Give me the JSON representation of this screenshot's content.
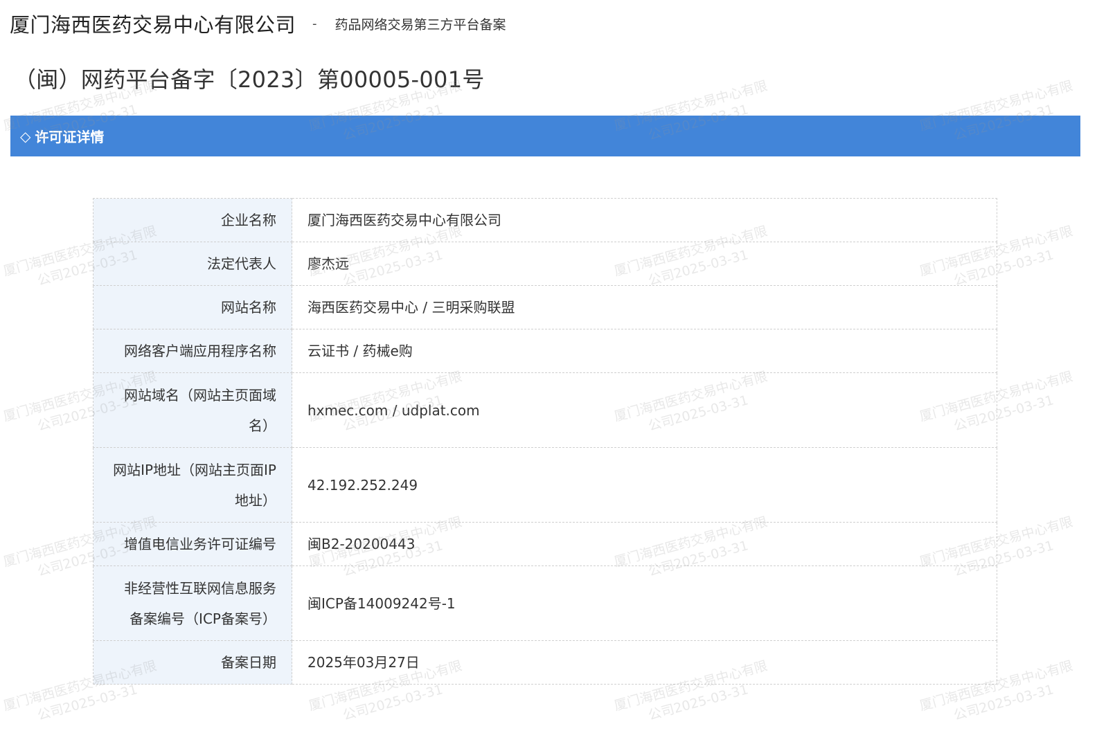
{
  "header": {
    "company": "厦门海西医药交易中心有限公司",
    "separator": "-",
    "subtitle": "药品网络交易第三方平台备案",
    "record_number": "（闽）网药平台备字〔2023〕第00005-001号"
  },
  "section": {
    "icon": "diamond-outline-icon",
    "icon_glyph": "◇",
    "title": "许可证详情",
    "bar_color": "#4285d9"
  },
  "rows": [
    {
      "label": "企业名称",
      "value": "厦门海西医药交易中心有限公司"
    },
    {
      "label": "法定代表人",
      "value": "廖杰远"
    },
    {
      "label": "网站名称",
      "value": "海西医药交易中心 / 三明采购联盟"
    },
    {
      "label": "网络客户端应用程序名称",
      "value": "云证书 / 药械e购"
    },
    {
      "label": "网站域名（网站主页面域名）",
      "value": "hxmec.com / udplat.com"
    },
    {
      "label": "网站IP地址（网站主页面IP地址）",
      "value": "42.192.252.249"
    },
    {
      "label": "增值电信业务许可证编号",
      "value": "闽B2-20200443"
    },
    {
      "label": "非经营性互联网信息服务备案编号（ICP备案号）",
      "value": "闽ICP备14009242号-1"
    },
    {
      "label": "备案日期",
      "value": "2025年03月27日"
    }
  ],
  "watermark": {
    "line1": "厦门海西医药交易中心有限",
    "line2": "公司2025-03-31"
  }
}
